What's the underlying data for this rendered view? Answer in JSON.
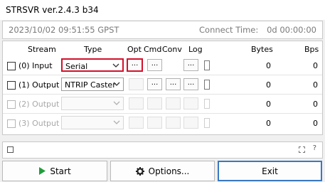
{
  "window": {
    "title": "STRSVR ver.2.4.3 b34"
  },
  "status": {
    "time": "2023/10/02 09:51:55 GPST",
    "connect_label": "Connect Time:",
    "connect_value": "0d 00:00:00"
  },
  "headers": {
    "stream": "Stream",
    "type": "Type",
    "opt": "Opt",
    "cmd": "Cmd",
    "conv": "Conv",
    "log": "Log",
    "bytes": "Bytes",
    "bps": "Bps"
  },
  "rows": [
    {
      "label": "(0) Input",
      "type": "Serial",
      "bytes": "0",
      "bps": "0"
    },
    {
      "label": "(1) Output",
      "type": "NTRIP Caster",
      "bytes": "0",
      "bps": "0"
    },
    {
      "label": "(2) Output",
      "type": "",
      "bytes": "0",
      "bps": "0"
    },
    {
      "label": "(3) Output",
      "type": "",
      "bytes": "0",
      "bps": "0"
    }
  ],
  "ellipsis": "...",
  "message_bar": {
    "help_mark": "?"
  },
  "buttons": {
    "start": "Start",
    "options": "Options...",
    "exit": "Exit"
  },
  "colors": {
    "highlight_red": "#d4102b",
    "start_green": "#1f9d3a",
    "default_blue": "#3a78c2"
  }
}
